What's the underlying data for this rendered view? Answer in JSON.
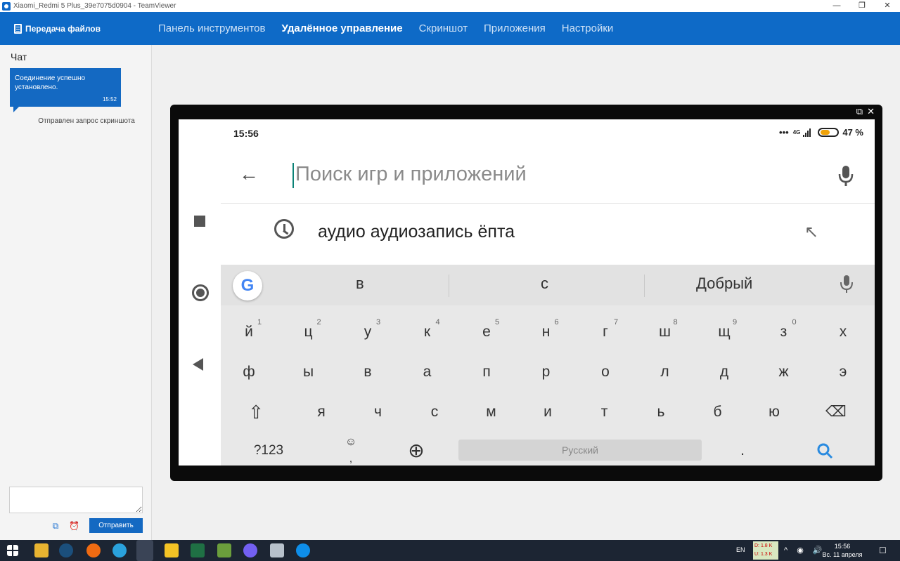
{
  "window": {
    "title": "Xiaomi_Redmi 5 Plus_39e7075d0904 - TeamViewer",
    "controls": [
      "—",
      "❐",
      "✕"
    ]
  },
  "nav": {
    "file_transfer": "Передача файлов",
    "tabs": [
      {
        "label": "Панель инструментов",
        "active": false
      },
      {
        "label": "Удалённое управление",
        "active": true
      },
      {
        "label": "Скриншот",
        "active": false
      },
      {
        "label": "Приложения",
        "active": false
      },
      {
        "label": "Настройки",
        "active": false
      }
    ],
    "colors": {
      "bar": "#0e6ac7",
      "active": "#ffffff",
      "inactive": "#cfe2f6"
    }
  },
  "chat": {
    "title": "Чат",
    "bubble_text": "Соединение успешно установлено.",
    "bubble_time": "15:52",
    "status": "Отправлен запрос скриншота",
    "input_value": "",
    "send_label": "Отправить",
    "action_icons": [
      "screenshot-icon",
      "alarm-icon"
    ]
  },
  "device": {
    "frame_icons": [
      "popout-icon",
      "close-icon"
    ],
    "status_time": "15:56",
    "status_dots": "•••",
    "network": "4G",
    "battery": "47 %",
    "battery_level": 0.47,
    "search_placeholder": "Поиск игр и приложений",
    "suggestion": "аудио аудиозапись ёпта",
    "keyboard": {
      "suggestions": [
        "в",
        "с",
        "Добрый"
      ],
      "row1": [
        {
          "k": "й",
          "n": "1"
        },
        {
          "k": "ц",
          "n": "2"
        },
        {
          "k": "у",
          "n": "3"
        },
        {
          "k": "к",
          "n": "4"
        },
        {
          "k": "е",
          "n": "5"
        },
        {
          "k": "н",
          "n": "6"
        },
        {
          "k": "г",
          "n": "7"
        },
        {
          "k": "ш",
          "n": "8"
        },
        {
          "k": "щ",
          "n": "9"
        },
        {
          "k": "з",
          "n": "0"
        },
        {
          "k": "х",
          "n": ""
        }
      ],
      "row2": [
        "ф",
        "ы",
        "в",
        "а",
        "п",
        "р",
        "о",
        "л",
        "д",
        "ж",
        "э"
      ],
      "row3": [
        "я",
        "ч",
        "с",
        "м",
        "и",
        "т",
        "ь",
        "б",
        "ю"
      ],
      "row4": {
        "symbols": "?123",
        "emoji": "☺",
        "comma": ",",
        "space": "Русский",
        "period": "."
      }
    }
  },
  "taskbar": {
    "lang": "EN",
    "net_down": "D: 1.8 K",
    "net_up": "U: 1.3 K",
    "time": "15:56",
    "date": "Вс. 11 апреля"
  }
}
